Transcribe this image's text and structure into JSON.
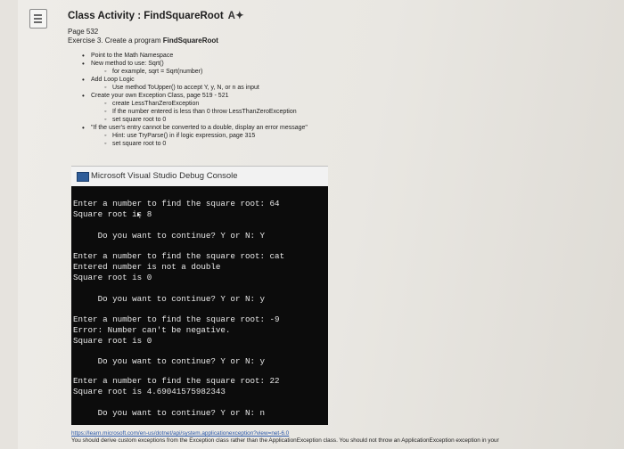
{
  "header": {
    "title": "Class Activity : FindSquareRoot",
    "ai_label": "A✦"
  },
  "meta": {
    "page": "Page 532",
    "exercise_prefix": "Exercise 3. Create a program ",
    "exercise_program": "FindSquareRoot"
  },
  "bullets": [
    {
      "level": 1,
      "text": "Point to the Math Namespace"
    },
    {
      "level": 1,
      "text": "New method to use: Sqrt()"
    },
    {
      "level": 2,
      "text": "for example, sqrt = Sqrt(number)"
    },
    {
      "level": 1,
      "text": "Add Loop Logic"
    },
    {
      "level": 2,
      "text": "Use method ToUpper() to accept Y, y, N, or n as input"
    },
    {
      "level": 1,
      "text": "Create your own Exception Class, page 519 - 521"
    },
    {
      "level": 2,
      "text": "create LessThanZeroException"
    },
    {
      "level": 2,
      "text": "If the number entered is less than 0 throw LessThanZeroException"
    },
    {
      "level": 2,
      "text": "set square root to 0"
    },
    {
      "level": 1,
      "text": "\"If the user's entry cannot be converted to a double, display an error message\""
    },
    {
      "level": 2,
      "text": "Hint: use TryParse() in if logic expression, page 315"
    },
    {
      "level": 2,
      "text": "set square root to 0"
    }
  ],
  "console": {
    "title": "Microsoft Visual Studio Debug Console",
    "lines": [
      "Enter a number to find the square root: 64",
      "Square root is 8",
      "",
      "     Do you want to continue? Y or N: Y",
      "",
      "Enter a number to find the square root: cat",
      "Entered number is not a double",
      "Square root is 0",
      "",
      "     Do you want to continue? Y or N: y",
      "",
      "Enter a number to find the square root: -9",
      "Error: Number can't be negative.",
      "Square root is 0",
      "",
      "     Do you want to continue? Y or N: y",
      "",
      "Enter a number to find the square root: 22",
      "Square root is 4.69041575982343",
      "",
      "     Do you want to continue? Y or N: n"
    ]
  },
  "footer": {
    "link": "https://learn.microsoft.com/en-us/dotnet/api/system.applicationexception?view=net-6.0",
    "note": "You should derive custom exceptions from the Exception class rather than the ApplicationException class. You should not throw an ApplicationException exception in your"
  }
}
